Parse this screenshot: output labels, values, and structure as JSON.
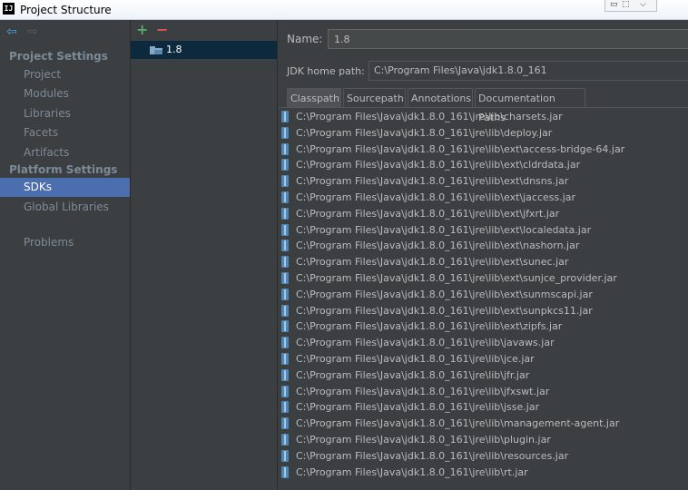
{
  "window": {
    "title": "Project Structure",
    "app_icon": "IJ",
    "controls": [
      "minimize",
      "maximize",
      "close"
    ]
  },
  "nav": {
    "back_icon": "back-arrow",
    "forward_icon": "forward-arrow"
  },
  "sidebar": {
    "project_settings_header": "Project Settings",
    "project_items": [
      "Project",
      "Modules",
      "Libraries",
      "Facets",
      "Artifacts"
    ],
    "platform_settings_header": "Platform Settings",
    "platform_items": [
      "SDKs",
      "Global Libraries"
    ],
    "selected": "SDKs",
    "problems": "Problems"
  },
  "sdk_list": {
    "add_icon": "+",
    "remove_icon": "−",
    "items": [
      "1.8"
    ]
  },
  "details": {
    "name_label": "Name:",
    "name_value": "1.8",
    "jdk_home_label": "JDK home path:",
    "jdk_home_value": "C:\\Program Files\\Java\\jdk1.8.0_161",
    "tabs": [
      "Classpath",
      "Sourcepath",
      "Annotations",
      "Documentation Paths"
    ],
    "active_tab": "Classpath",
    "classpath": [
      "C:\\Program Files\\Java\\jdk1.8.0_161\\jre\\lib\\charsets.jar",
      "C:\\Program Files\\Java\\jdk1.8.0_161\\jre\\lib\\deploy.jar",
      "C:\\Program Files\\Java\\jdk1.8.0_161\\jre\\lib\\ext\\access-bridge-64.jar",
      "C:\\Program Files\\Java\\jdk1.8.0_161\\jre\\lib\\ext\\cldrdata.jar",
      "C:\\Program Files\\Java\\jdk1.8.0_161\\jre\\lib\\ext\\dnsns.jar",
      "C:\\Program Files\\Java\\jdk1.8.0_161\\jre\\lib\\ext\\jaccess.jar",
      "C:\\Program Files\\Java\\jdk1.8.0_161\\jre\\lib\\ext\\jfxrt.jar",
      "C:\\Program Files\\Java\\jdk1.8.0_161\\jre\\lib\\ext\\localedata.jar",
      "C:\\Program Files\\Java\\jdk1.8.0_161\\jre\\lib\\ext\\nashorn.jar",
      "C:\\Program Files\\Java\\jdk1.8.0_161\\jre\\lib\\ext\\sunec.jar",
      "C:\\Program Files\\Java\\jdk1.8.0_161\\jre\\lib\\ext\\sunjce_provider.jar",
      "C:\\Program Files\\Java\\jdk1.8.0_161\\jre\\lib\\ext\\sunmscapi.jar",
      "C:\\Program Files\\Java\\jdk1.8.0_161\\jre\\lib\\ext\\sunpkcs11.jar",
      "C:\\Program Files\\Java\\jdk1.8.0_161\\jre\\lib\\ext\\zipfs.jar",
      "C:\\Program Files\\Java\\jdk1.8.0_161\\jre\\lib\\javaws.jar",
      "C:\\Program Files\\Java\\jdk1.8.0_161\\jre\\lib\\jce.jar",
      "C:\\Program Files\\Java\\jdk1.8.0_161\\jre\\lib\\jfr.jar",
      "C:\\Program Files\\Java\\jdk1.8.0_161\\jre\\lib\\jfxswt.jar",
      "C:\\Program Files\\Java\\jdk1.8.0_161\\jre\\lib\\jsse.jar",
      "C:\\Program Files\\Java\\jdk1.8.0_161\\jre\\lib\\management-agent.jar",
      "C:\\Program Files\\Java\\jdk1.8.0_161\\jre\\lib\\plugin.jar",
      "C:\\Program Files\\Java\\jdk1.8.0_161\\jre\\lib\\resources.jar",
      "C:\\Program Files\\Java\\jdk1.8.0_161\\jre\\lib\\rt.jar"
    ]
  },
  "colors": {
    "background": "#3c3f41",
    "selection": "#4b6eaf",
    "sdk_selection": "#0d293e",
    "add": "#59a869",
    "remove": "#e05555"
  }
}
